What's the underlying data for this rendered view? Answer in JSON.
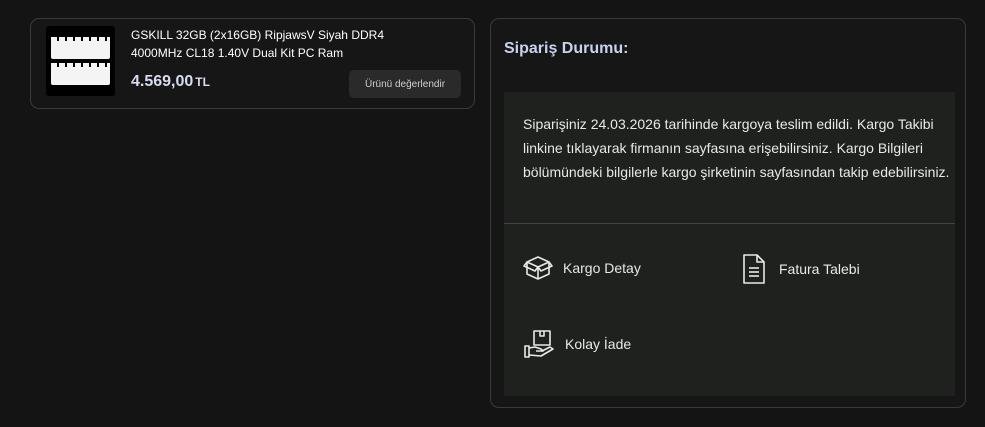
{
  "product": {
    "title": "GSKILL 32GB (2x16GB) RipjawsV Siyah DDR4 4000MHz CL18 1.40V Dual Kit PC Ram",
    "price": "4.569,00",
    "currency": "TL",
    "review_button": "Ürünü değerlendir",
    "image_icon": "ram-modules-image"
  },
  "order_status": {
    "title": "Sipariş Durumu:",
    "message": "Siparişiniz 24.03.2026 tarihinde kargoya teslim edildi. Kargo Takibi linkine tıklayarak firmanın sayfasına erişebilirsiniz. Kargo Bilgileri bölümündeki bilgilerle kargo şirketinin sayfasından takip edebilirsiniz.",
    "actions": [
      {
        "label": "Kargo Detay",
        "icon": "box-icon"
      },
      {
        "label": "Fatura Talebi",
        "icon": "document-icon"
      },
      {
        "label": "Kolay İade",
        "icon": "return-package-icon"
      }
    ]
  },
  "colors": {
    "background": "#141414",
    "card_border": "#3a3a3a",
    "status_title": "#c9d3ee",
    "price": "#d9dcef",
    "panel_body": "#1f211f"
  }
}
